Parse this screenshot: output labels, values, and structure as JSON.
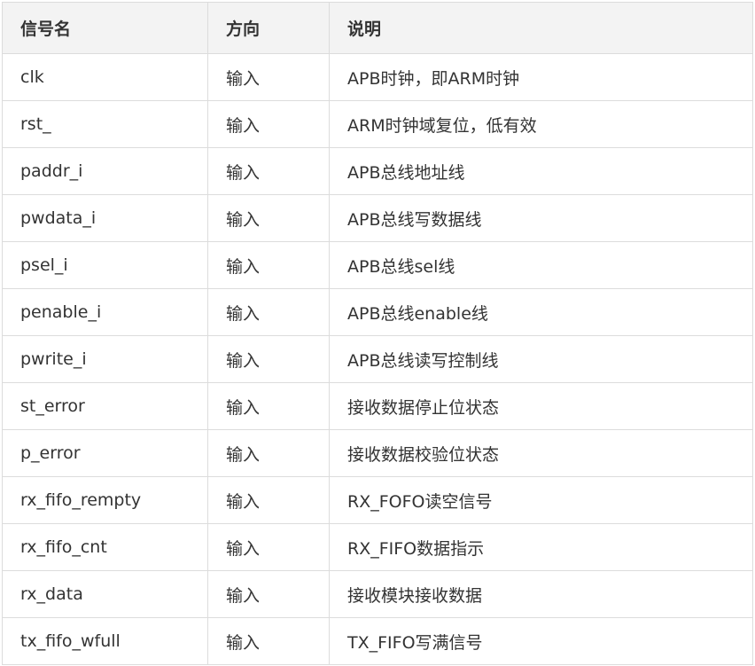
{
  "table": {
    "headers": [
      "信号名",
      "方向",
      "说明"
    ],
    "rows": [
      [
        "clk",
        "输入",
        "APB时钟，即ARM时钟"
      ],
      [
        "rst_",
        "输入",
        "ARM时钟域复位，低有效"
      ],
      [
        "paddr_i",
        "输入",
        "APB总线地址线"
      ],
      [
        "pwdata_i",
        "输入",
        "APB总线写数据线"
      ],
      [
        "psel_i",
        "输入",
        "APB总线sel线"
      ],
      [
        "penable_i",
        "输入",
        "APB总线enable线"
      ],
      [
        "pwrite_i",
        "输入",
        "APB总线读写控制线"
      ],
      [
        "st_error",
        "输入",
        "接收数据停止位状态"
      ],
      [
        "p_error",
        "输入",
        "接收数据校验位状态"
      ],
      [
        "rx_fifo_rempty",
        "输入",
        "RX_FOFO读空信号"
      ],
      [
        "rx_fifo_cnt",
        "输入",
        "RX_FIFO数据指示"
      ],
      [
        "rx_data",
        "输入",
        "接收模块接收数据"
      ],
      [
        "tx_fifo_wfull",
        "输入",
        "TX_FIFO写满信号"
      ]
    ]
  }
}
